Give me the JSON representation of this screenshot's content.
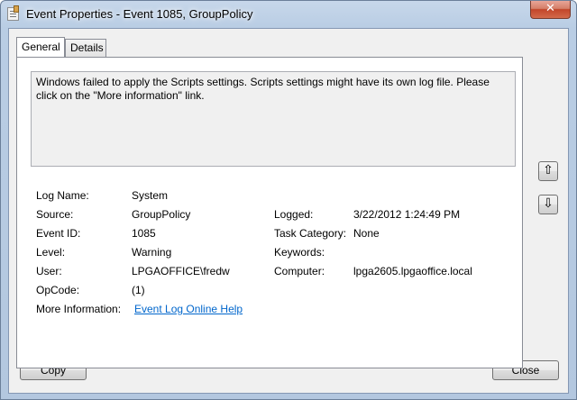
{
  "window": {
    "title": "Event Properties - Event 1085, GroupPolicy",
    "close_glyph": "✕"
  },
  "tabs": [
    {
      "label": "General",
      "selected": true
    },
    {
      "label": "Details",
      "selected": false
    }
  ],
  "message": "Windows failed to apply the Scripts settings. Scripts settings might have its own log file. Please click on the \"More information\" link.",
  "fields": {
    "log_name": {
      "label": "Log Name:",
      "value": "System"
    },
    "source": {
      "label": "Source:",
      "value": "GroupPolicy"
    },
    "event_id": {
      "label": "Event ID:",
      "value": "1085"
    },
    "level": {
      "label": "Level:",
      "value": "Warning"
    },
    "user": {
      "label": "User:",
      "value": "LPGAOFFICE\\fredw"
    },
    "opcode": {
      "label": "OpCode:",
      "value": "(1)"
    },
    "more_info": {
      "label": "More Information:",
      "value": "Event Log Online Help"
    },
    "logged": {
      "label": "Logged:",
      "value": "3/22/2012 1:24:49 PM"
    },
    "task_category": {
      "label": "Task Category:",
      "value": "None"
    },
    "keywords": {
      "label": "Keywords:",
      "value": ""
    },
    "computer": {
      "label": "Computer:",
      "value": "lpga2605.lpgaoffice.local"
    }
  },
  "nav": {
    "up_icon": "arrow-up-icon",
    "down_icon": "arrow-down-icon",
    "up_glyph": "⇧",
    "down_glyph": "⇩"
  },
  "buttons": {
    "copy": "Copy",
    "close": "Close"
  }
}
